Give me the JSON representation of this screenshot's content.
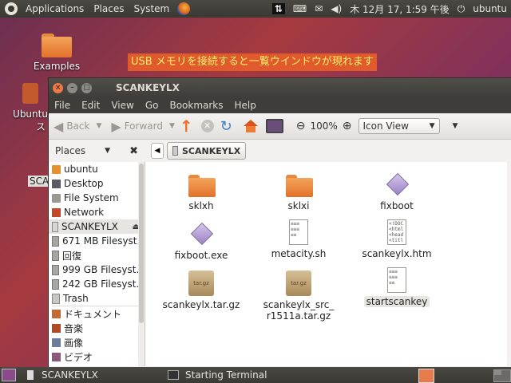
{
  "top_panel": {
    "menus": [
      "Applications",
      "Places",
      "System"
    ],
    "clock": "木 12月 17,  1:59 午後",
    "user": "ubuntu"
  },
  "desktop": {
    "icons": [
      {
        "label": "Examples"
      },
      {
        "label": "Ubuntu"
      },
      {
        "label": "ス"
      },
      {
        "label": "SCA"
      }
    ]
  },
  "banner": {
    "text": "USB メモリを接続すると一覧ウインドウが現れます"
  },
  "window": {
    "title": "SCANKEYLX",
    "menus": [
      "File",
      "Edit",
      "View",
      "Go",
      "Bookmarks",
      "Help"
    ],
    "toolbar": {
      "back": "Back",
      "forward": "Forward",
      "zoom": "100%",
      "view_mode": "Icon View"
    },
    "places_label": "Places",
    "breadcrumb": "SCANKEYLX",
    "sidebar": [
      {
        "label": "ubuntu",
        "icon": "home-folder-icon"
      },
      {
        "label": "Desktop",
        "icon": "desktop-icon"
      },
      {
        "label": "File System",
        "icon": "filesystem-icon"
      },
      {
        "label": "Network",
        "icon": "network-icon"
      },
      {
        "label": "SCANKEYLX",
        "icon": "usb-drive-icon"
      },
      {
        "label": "671 MB Filesyst...",
        "icon": "disk-icon"
      },
      {
        "label": "回復",
        "icon": "disk-icon"
      },
      {
        "label": "999 GB Filesyst...",
        "icon": "disk-icon"
      },
      {
        "label": "242 GB Filesyst...",
        "icon": "disk-icon"
      },
      {
        "label": "Trash",
        "icon": "trash-icon"
      },
      {
        "label": "ドキュメント",
        "icon": "documents-icon"
      },
      {
        "label": "音楽",
        "icon": "music-icon"
      },
      {
        "label": "画像",
        "icon": "pictures-icon"
      },
      {
        "label": "ビデオ",
        "icon": "videos-icon"
      }
    ],
    "files": [
      {
        "name": "sklxh",
        "type": "folder"
      },
      {
        "name": "sklxi",
        "type": "folder"
      },
      {
        "name": "fixboot",
        "type": "exe"
      },
      {
        "name": "fixboot.exe",
        "type": "exe"
      },
      {
        "name": "metacity.sh",
        "type": "text"
      },
      {
        "name": "scankeylx.htm",
        "type": "html"
      },
      {
        "name": "scankeylx.tar.gz",
        "type": "tar"
      },
      {
        "name": "scankeylx_src_",
        "name2": "r1511a.tar.gz",
        "type": "tar"
      },
      {
        "name": "startscankey",
        "type": "text"
      }
    ],
    "file_badges": {
      "html_snippet": "<!DOC\n<html\n<head\n<titl",
      "tar": "tar.gz"
    }
  },
  "bottom_panel": {
    "tasks": [
      "SCANKEYLX",
      "Starting Terminal"
    ]
  }
}
